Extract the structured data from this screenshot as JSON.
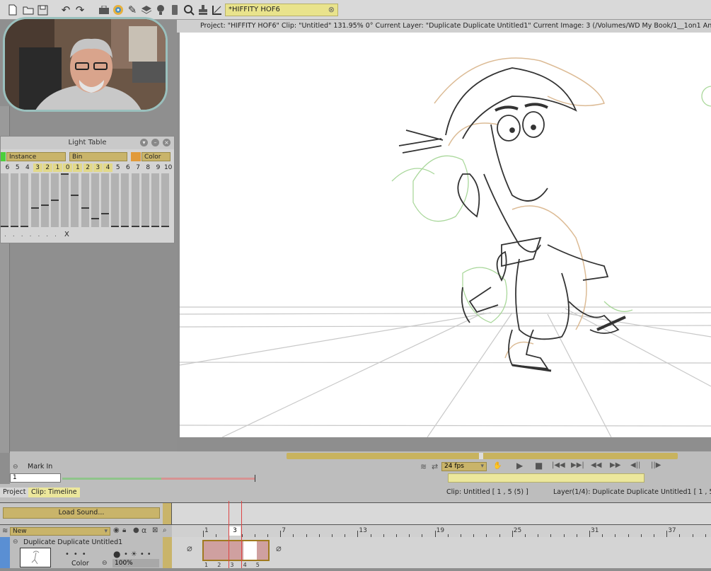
{
  "toolbar": {
    "project_field": "*HIFFITY HOF6",
    "icons": [
      "new-doc-icon",
      "open-folder-icon",
      "save-icon",
      "undo-icon",
      "redo-icon",
      "toolbox-icon",
      "color-wheel-icon",
      "brush-icon",
      "layers-icon",
      "lightbulb-icon",
      "mobile-icon",
      "zoom-icon",
      "stamp-icon",
      "transform-icon"
    ]
  },
  "status_bar": {
    "text": "Project:  \"HIFFITY HOF6\"  Clip: \"Untitled\"   131.95%   0°   Current Layer: \"Duplicate Duplicate Untitled1\"   Current Image: 3 (/Volumes/WD My Book/1__1on1 Anim"
  },
  "light_table": {
    "title": "Light Table",
    "headers": [
      "Instance",
      "Bin",
      "Color"
    ],
    "numbers": [
      "6",
      "5",
      "4",
      "3",
      "2",
      "1",
      "0",
      "1",
      "2",
      "3",
      "4",
      "5",
      "6",
      "7",
      "8",
      "9",
      "10"
    ],
    "levels": [
      0,
      0,
      0,
      0.35,
      0.4,
      0.5,
      1,
      0.6,
      0.35,
      0.15,
      0.25,
      0,
      0,
      0,
      0,
      0,
      0
    ],
    "x_label": "X"
  },
  "transport": {
    "mark_in": "Mark In",
    "mark_in_value": "1",
    "fps": "24 fps"
  },
  "bottom": {
    "tab_project": "Project",
    "tab_clip": "Clip: Timeline",
    "clip_info": "Clip: Untitled [ 1 , 5  (5) ]",
    "layer_info": "Layer(1/4): Duplicate Duplicate Untitled1 [ 1 , 5  (",
    "load_sound": "Load Sound...",
    "new_label": "New",
    "layer_name": "Duplicate Duplicate Untitled1",
    "color_label": "Color",
    "opacity": "100%",
    "ruler": [
      "1",
      "3",
      "7",
      "13",
      "19",
      "25",
      "31",
      "37"
    ],
    "frame_numbers": [
      "1",
      "2",
      "3",
      "4",
      "5"
    ],
    "current_frame": "3"
  }
}
